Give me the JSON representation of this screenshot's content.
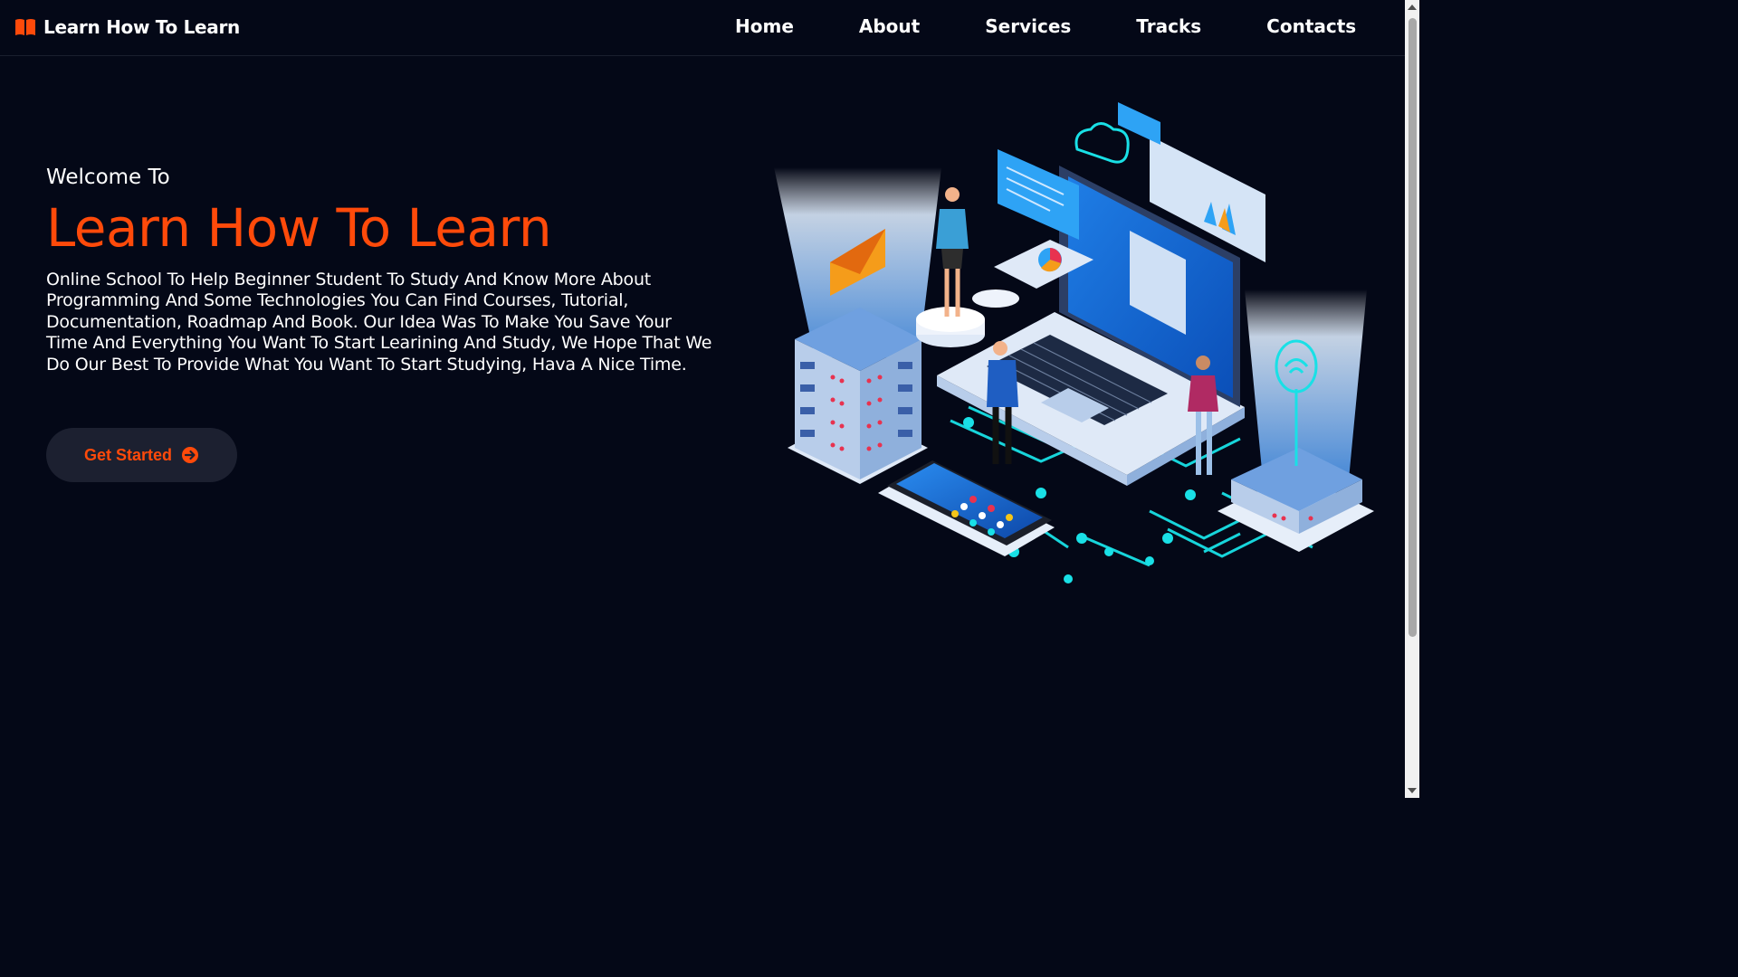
{
  "brand": {
    "name": "Learn How To Learn",
    "icon": "open-book-icon",
    "icon_color": "#ff4a0a"
  },
  "nav": {
    "items": [
      {
        "label": "Home"
      },
      {
        "label": "About"
      },
      {
        "label": "Services"
      },
      {
        "label": "Tracks"
      },
      {
        "label": "Contacts"
      }
    ]
  },
  "hero": {
    "welcome": "Welcome To",
    "title": "Learn How To Learn",
    "description": "Online School To Help Beginner Student To Study And Know More About Programming And Some Technologies You Can Find Courses, Tutorial, Documentation, Roadmap And Book. Our Idea Was To Make You Save Your Time And Everything You Want To Start Learining And Study, We Hope That We Do Our Best To Provide What You Want To Start Studying, Hava A Nice Time.",
    "cta_label": "Get Started",
    "cta_icon": "arrow-right-circle-icon",
    "illustration": "isometric-online-learning-illustration"
  },
  "colors": {
    "background": "#040817",
    "accent": "#ff4a0a",
    "button_bg": "#1c2030",
    "text": "#ffffff"
  }
}
